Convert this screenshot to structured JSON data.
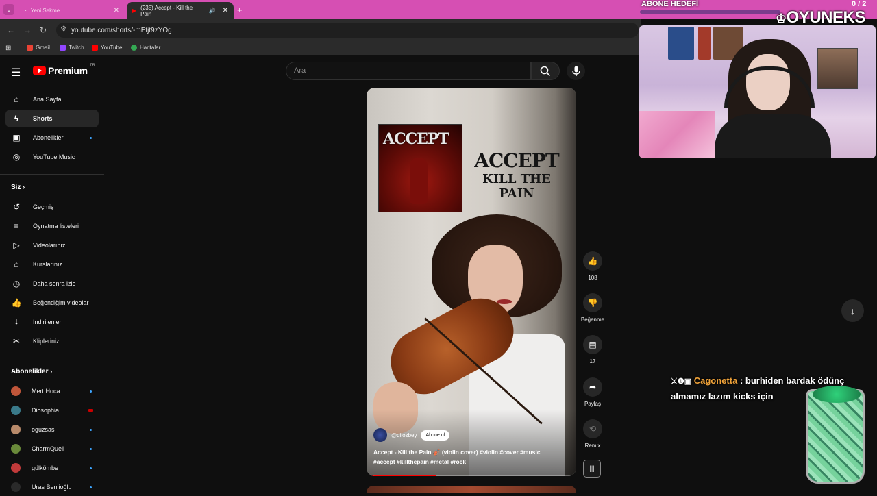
{
  "browser": {
    "tabs": [
      {
        "label": "Yeni Sekme"
      },
      {
        "label": "(235) Accept - Kill the Pain"
      }
    ],
    "url": "youtube.com/shorts/-mEtjt9zYOg",
    "bookmarks": [
      {
        "label": "Gmail",
        "color": "#ea4335"
      },
      {
        "label": "Twitch",
        "color": "#9146ff"
      },
      {
        "label": "YouTube",
        "color": "#ff0000"
      },
      {
        "label": "Haritalar",
        "color": "#34a853"
      }
    ]
  },
  "youtube": {
    "logo_text": "Premium",
    "logo_region": "TR",
    "search_placeholder": "Ara",
    "sidebar": {
      "main": [
        {
          "label": "Ana Sayfa",
          "icon": "home-icon"
        },
        {
          "label": "Shorts",
          "icon": "shorts-icon"
        },
        {
          "label": "Abonelikler",
          "icon": "subscriptions-icon"
        },
        {
          "label": "YouTube Music",
          "icon": "music-icon"
        }
      ],
      "you_title": "Siz",
      "you": [
        {
          "label": "Geçmiş",
          "icon": "history-icon"
        },
        {
          "label": "Oynatma listeleri",
          "icon": "playlists-icon"
        },
        {
          "label": "Videolarınız",
          "icon": "your-videos-icon"
        },
        {
          "label": "Kurslarınız",
          "icon": "courses-icon"
        },
        {
          "label": "Daha sonra izle",
          "icon": "watch-later-icon"
        },
        {
          "label": "Beğendiğim videolar",
          "icon": "liked-icon"
        },
        {
          "label": "İndirilenler",
          "icon": "downloads-icon"
        },
        {
          "label": "Klipleriniz",
          "icon": "clips-icon"
        }
      ],
      "subs_title": "Abonelikler",
      "subs": [
        {
          "label": "Mert Hoca",
          "color": "#c0563a"
        },
        {
          "label": "Diosophia",
          "color": "#3a7a8a"
        },
        {
          "label": "oguzsasi",
          "color": "#b88a6a"
        },
        {
          "label": "CharmQuell",
          "color": "#6a8a3a"
        },
        {
          "label": "gülkömbe",
          "color": "#c03a3a"
        },
        {
          "label": "Uras Benlioğlu",
          "color": "#2a2a2a"
        }
      ]
    },
    "short": {
      "cover_band": "ACCEPT",
      "song_line1": "ACCEPT",
      "song_line2": "KILL THE PAIN",
      "channel": "@dilozbey",
      "subscribe_label": "Abone ol",
      "description_line1": "Accept - Kill the Pain 🎻 (violin cover) #violin #cover #music",
      "description_line2": "#accept #killthepain #metal #rock",
      "progress_fraction": 0.33
    },
    "actions": {
      "likes": "108",
      "dislike_label": "Beğenme",
      "comments": "17",
      "share_label": "Paylaş",
      "remix_label": "Remix"
    }
  },
  "stream_overlay": {
    "goal_label": "ABONE HEDEFİ",
    "goal_count": "0 / 2",
    "brand": "OYUNEKS",
    "chat": {
      "user": "Cagonetta",
      "message_line1": ": burhiden bardak ödünç",
      "message_line2": "almamız lazım kicks için"
    }
  }
}
